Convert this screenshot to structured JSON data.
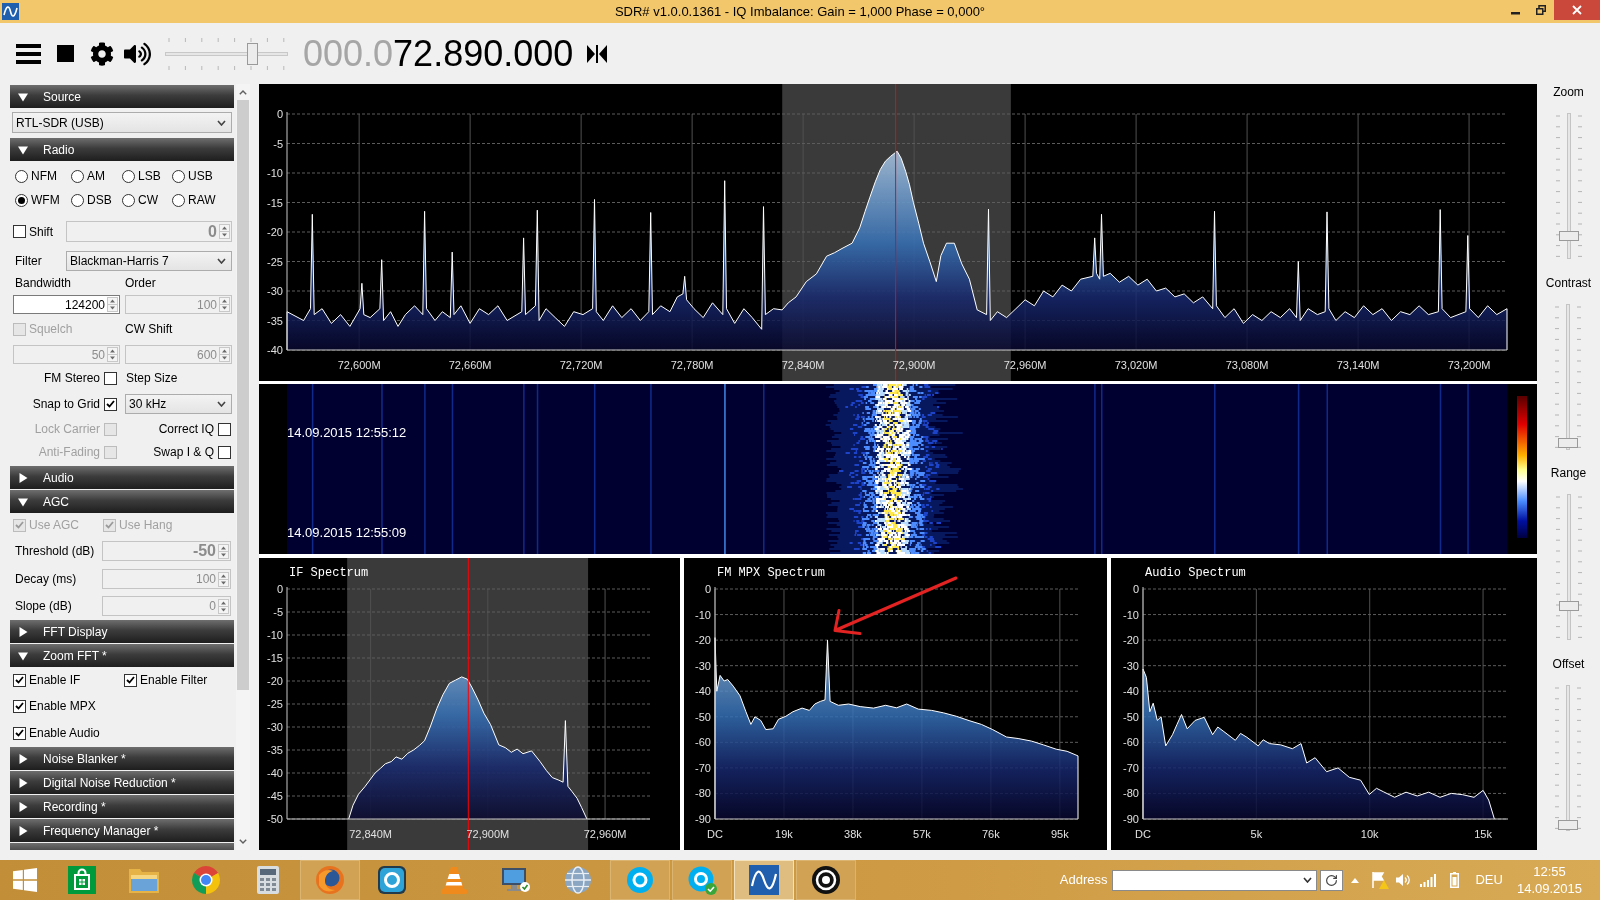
{
  "window": {
    "title": "SDR# v1.0.0.1361 - IQ Imbalance: Gain = 1,000 Phase = 0,000°"
  },
  "toolbar": {
    "volume": {
      "level": 0.72
    },
    "frequency": {
      "leading": "000.0",
      "digits": "72.890.000"
    }
  },
  "sidebar": {
    "sections": [
      {
        "title": "Source",
        "expanded": true,
        "kind": "source",
        "device": "RTL-SDR (USB)"
      },
      {
        "title": "Radio",
        "expanded": true,
        "kind": "radio",
        "modes": [
          {
            "label": "NFM",
            "selected": false
          },
          {
            "label": "AM",
            "selected": false
          },
          {
            "label": "LSB",
            "selected": false
          },
          {
            "label": "USB",
            "selected": false
          },
          {
            "label": "WFM",
            "selected": true
          },
          {
            "label": "DSB",
            "selected": false
          },
          {
            "label": "CW",
            "selected": false
          },
          {
            "label": "RAW",
            "selected": false
          }
        ],
        "shift": {
          "label": "Shift",
          "checked": false,
          "disabled": false
        },
        "shift_value": {
          "value": "0",
          "disabled": true
        },
        "filter": {
          "label": "Filter",
          "value": "Blackman-Harris 7"
        },
        "bandwidth": {
          "label": "Bandwidth",
          "value": "124200",
          "disabled": false
        },
        "order": {
          "label": "Order",
          "value": "100",
          "disabled": true
        },
        "squelch": {
          "label": "Squelch",
          "checked": false,
          "disabled": true
        },
        "squelch_value": {
          "value": "50",
          "disabled": true
        },
        "cw_shift": {
          "label": "CW Shift",
          "value": "600",
          "disabled": true
        },
        "fm_stereo": {
          "label": "FM Stereo",
          "checked": false,
          "disabled": false
        },
        "step_size": {
          "label": "Step Size",
          "value": "30 kHz"
        },
        "snap_to_grid": {
          "label": "Snap to Grid",
          "checked": true,
          "disabled": false
        },
        "lock_carrier": {
          "label": "Lock Carrier",
          "checked": false,
          "disabled": true
        },
        "correct_iq": {
          "label": "Correct IQ",
          "checked": false,
          "disabled": false
        },
        "anti_fading": {
          "label": "Anti-Fading",
          "checked": false,
          "disabled": true
        },
        "swap_iq": {
          "label": "Swap I & Q",
          "checked": false,
          "disabled": false
        }
      },
      {
        "title": "Audio",
        "expanded": false
      },
      {
        "title": "AGC",
        "expanded": true,
        "kind": "agc",
        "use_agc": {
          "label": "Use AGC",
          "checked": true,
          "disabled": true
        },
        "use_hang": {
          "label": "Use Hang",
          "checked": true,
          "disabled": true
        },
        "fields": [
          {
            "label": "Threshold (dB)",
            "value": "-50",
            "disabled": true
          },
          {
            "label": "Decay (ms)",
            "value": "100",
            "disabled": true
          },
          {
            "label": "Slope (dB)",
            "value": "0",
            "disabled": true
          }
        ]
      },
      {
        "title": "FFT Display",
        "expanded": false
      },
      {
        "title": "Zoom FFT *",
        "expanded": true,
        "kind": "zoom_fft",
        "options": [
          {
            "label": "Enable IF",
            "checked": true,
            "disabled": false
          },
          {
            "label": "Enable Filter",
            "checked": true,
            "disabled": false
          },
          {
            "label": "Enable MPX",
            "checked": true,
            "disabled": false
          },
          {
            "label": "Enable Audio",
            "checked": true,
            "disabled": false
          }
        ]
      },
      {
        "title": "Noise Blanker *",
        "expanded": false
      },
      {
        "title": "Digital Noise Reduction *",
        "expanded": false
      },
      {
        "title": "Recording *",
        "expanded": false
      },
      {
        "title": "Frequency Manager *",
        "expanded": false
      }
    ]
  },
  "spectrum": {
    "chart_data": {
      "type": "area",
      "grid": true,
      "xlim": [
        72561,
        73220.5
      ],
      "ylim": [
        -40,
        0
      ],
      "xticks": [
        {
          "value": 72600,
          "label": "72,600M"
        },
        {
          "value": 72660,
          "label": "72,660M"
        },
        {
          "value": 72720,
          "label": "72,720M"
        },
        {
          "value": 72780,
          "label": "72,780M"
        },
        {
          "value": 72840,
          "label": "72,840M"
        },
        {
          "value": 72900,
          "label": "72,900M"
        },
        {
          "value": 72960,
          "label": "72,960M"
        },
        {
          "value": 73020,
          "label": "73,020M"
        },
        {
          "value": 73080,
          "label": "73,080M"
        },
        {
          "value": 73140,
          "label": "73,140M"
        },
        {
          "value": 73200,
          "label": "73,200M"
        }
      ],
      "yticks": [
        0,
        -5,
        -10,
        -15,
        -20,
        -25,
        -30,
        -35,
        -40
      ],
      "x": [
        72561,
        72561,
        72570,
        72573.7,
        72574.7,
        72575.7,
        72580,
        72585,
        72590,
        72595,
        72600.5,
        72601.5,
        72602.5,
        72606,
        72611.2,
        72612.2,
        72613.2,
        72617,
        72621,
        72625,
        72630,
        72634.4,
        72635.4,
        72636.4,
        72641,
        72645,
        72649.3,
        72650.3,
        72651.3,
        72655,
        72660,
        72665,
        72670,
        72675,
        72680,
        72687.9,
        72688.9,
        72689.9,
        72695.3,
        72696.3,
        72697.3,
        72701,
        72706,
        72711,
        72716,
        72721,
        72726.2,
        72727.2,
        72728.2,
        72732,
        72737,
        72742,
        72747,
        72752,
        72756.6,
        72757.6,
        72758.6,
        72763,
        72768,
        72772,
        72775,
        72776,
        72777,
        72781,
        72786,
        72791,
        72796.6,
        72797.6,
        72798.6,
        72803,
        72808,
        72812.5,
        72817.6,
        72818.6,
        72819.6,
        72824,
        72828.7,
        72832,
        72836.2,
        72841.7,
        72847.2,
        72852.7,
        72857,
        72861,
        72866.5,
        72870.6,
        72873.5,
        72876.1,
        72879,
        72881.7,
        72884.5,
        72887.2,
        72890.8,
        72893,
        72895.5,
        72897.5,
        72899.6,
        72902.5,
        72905.1,
        72908.5,
        72912,
        72914.5,
        72917.5,
        72921.7,
        72925.8,
        72929.9,
        72934.1,
        72939.2,
        72940.2,
        72941.2,
        72945,
        72950,
        72955,
        72960,
        72965,
        72970,
        72975,
        72980,
        72985,
        72990,
        72996.6,
        72997.6,
        72998.6,
        73000.3,
        73001.3,
        73002.3,
        73006,
        73011,
        73016,
        73021,
        73026,
        73031,
        73036,
        73041,
        73046,
        73051,
        73056,
        73061.4,
        73062.4,
        73063.4,
        73068,
        73073,
        73078,
        73083,
        73088,
        73093,
        73098,
        73103,
        73106.7,
        73107.7,
        73108.7,
        73113,
        73118,
        73122.2,
        73123.2,
        73124.2,
        73128,
        73133,
        73138,
        73143,
        73148,
        73153,
        73158,
        73163,
        73168,
        73173,
        73178,
        73183.4,
        73184.4,
        73185.4,
        73190,
        73198.3,
        73199.3,
        73200.3,
        73205,
        73210,
        73215,
        73220.5,
        73220.5
      ],
      "values": [
        -40,
        -33.5,
        -35,
        -33,
        -17,
        -34,
        -33,
        -35.5,
        -34,
        -36,
        -33,
        -28.7,
        -34,
        -34.5,
        -33,
        -24.7,
        -35,
        -33.5,
        -36,
        -34,
        -32.5,
        -34,
        -16.5,
        -33,
        -35,
        -33.5,
        -34.5,
        -23.4,
        -34,
        -32.5,
        -35.5,
        -33,
        -34,
        -32.5,
        -35,
        -33.5,
        -21,
        -34,
        -32.5,
        -16.3,
        -35,
        -33,
        -34.5,
        -36,
        -33.5,
        -34,
        -33,
        -14.5,
        -33.5,
        -35,
        -32.5,
        -34.5,
        -33,
        -35,
        -33.5,
        -16.7,
        -34,
        -32.5,
        -33.5,
        -31,
        -30.5,
        -27.5,
        -31.5,
        -33,
        -34.5,
        -32,
        -34,
        -11.3,
        -33,
        -35.5,
        -33,
        -34.5,
        -36.5,
        -15.7,
        -34,
        -33,
        -33.2,
        -32,
        -31,
        -28.4,
        -27.1,
        -24.1,
        -23.5,
        -22.8,
        -21.9,
        -19.3,
        -16.5,
        -14.1,
        -11.5,
        -9.4,
        -8,
        -7.2,
        -6.3,
        -7.5,
        -9.8,
        -12,
        -15,
        -18.5,
        -21.9,
        -25,
        -28.4,
        -24,
        -21.9,
        -21.9,
        -25.4,
        -28,
        -33.2,
        -34,
        -16.1,
        -35,
        -33.5,
        -34.5,
        -33,
        -31.5,
        -32.5,
        -30,
        -31,
        -29,
        -30,
        -28,
        -27.5,
        -21,
        -27,
        -28,
        -17,
        -27.5,
        -27,
        -28.5,
        -27.5,
        -29,
        -28,
        -30,
        -29.5,
        -31,
        -30.5,
        -32,
        -31,
        -33,
        -16.5,
        -32.5,
        -34.5,
        -33,
        -35.5,
        -34,
        -35,
        -33.5,
        -34.5,
        -33,
        -34.5,
        -25,
        -35,
        -33,
        -34,
        -33.5,
        -16.6,
        -33,
        -35,
        -33.5,
        -34.5,
        -32.5,
        -34,
        -33,
        -35,
        -33.5,
        -34,
        -32.5,
        -34,
        -33.5,
        -16.2,
        -33,
        -34.5,
        -33.5,
        -20.6,
        -33,
        -34.5,
        -32.5,
        -34,
        -33,
        -40
      ],
      "bands": [
        {
          "axis": "x",
          "from": 72828.7,
          "to": 72952.3
        }
      ],
      "ref_lines": [
        {
          "axis": "x",
          "value": 72890
        }
      ]
    }
  },
  "waterfall": {
    "timestamps": [
      "14.09.2015 12:55:12",
      "14.09.2015 12:55:09"
    ]
  },
  "zoom_spectra": [
    {
      "chart_data": {
        "type": "area",
        "grid": true,
        "title": "IF Spectrum",
        "xlim": [
          72797.2,
          72983
        ],
        "ylim": [
          -50,
          0
        ],
        "xticks": [
          {
            "value": 72840,
            "label": "72,840M"
          },
          {
            "value": 72900,
            "label": "72,900M"
          },
          {
            "value": 72960,
            "label": "72,960M"
          }
        ],
        "yticks": [
          0,
          -5,
          -10,
          -15,
          -20,
          -25,
          -30,
          -35,
          -40,
          -45,
          -50
        ],
        "x": [
          72828.8,
          72831,
          72833.8,
          72837,
          72842.3,
          72845,
          72847.5,
          72850.7,
          72853,
          72856,
          72859.1,
          72862,
          72865,
          72867.6,
          72870.5,
          72873.9,
          72877,
          72880.3,
          72883.5,
          72886.6,
          72889.5,
          72892,
          72895,
          72898,
          72901.4,
          72905.6,
          72909,
          72912,
          72915,
          72918,
          72922.4,
          72926.7,
          72930,
          72933,
          72936,
          72938.5,
          72939.7,
          72941,
          72943,
          72945.7,
          72948,
          72950.7
        ],
        "values": [
          -50,
          -47,
          -44.6,
          -43,
          -40,
          -39,
          -38,
          -37.5,
          -36.5,
          -37,
          -35.7,
          -35,
          -34,
          -33,
          -30,
          -26,
          -23,
          -20.5,
          -19.8,
          -19.1,
          -19.6,
          -21.5,
          -24.1,
          -27,
          -29.5,
          -33.9,
          -34.5,
          -35.5,
          -34.8,
          -35.8,
          -35.2,
          -37.5,
          -39.5,
          -41,
          -41.5,
          -42,
          -28.6,
          -42.9,
          -44,
          -45.5,
          -47.5,
          -50
        ],
        "bands": [
          {
            "axis": "x",
            "from": 72828,
            "to": 72951.3
          }
        ],
        "ref_lines": [
          {
            "axis": "x",
            "value": 72890
          }
        ]
      }
    },
    {
      "chart_data": {
        "type": "area",
        "grid": true,
        "title": "FM MPX Spectrum",
        "xlim": [
          0,
          100
        ],
        "ylim": [
          -90,
          0
        ],
        "xticks": [
          {
            "value": 0,
            "label": "DC"
          },
          {
            "value": 19,
            "label": "19k"
          },
          {
            "value": 38,
            "label": "38k"
          },
          {
            "value": 57,
            "label": "57k"
          },
          {
            "value": 76,
            "label": "76k"
          },
          {
            "value": 95,
            "label": "95k"
          }
        ],
        "yticks": [
          0,
          -10,
          -20,
          -30,
          -40,
          -50,
          -60,
          -70,
          -80,
          -90
        ],
        "x": [
          0,
          0,
          0.5,
          1.4,
          2.5,
          3.5,
          5,
          6.9,
          8.5,
          9.9,
          11,
          12.6,
          14,
          16,
          17.5,
          19.5,
          21.5,
          24,
          26,
          27.5,
          29,
          30.3,
          31,
          31.7,
          34,
          36.8,
          40,
          43.7,
          47,
          50,
          52.8,
          56,
          59.7,
          63,
          66.5,
          70,
          73.4,
          76.5,
          80.3,
          83.5,
          87.2,
          90.5,
          94,
          97,
          100,
          100
        ],
        "values": [
          -90,
          -19,
          -40,
          -33.8,
          -36,
          -35.4,
          -38,
          -41.8,
          -48,
          -53,
          -50,
          -51.4,
          -55,
          -54.7,
          -51,
          -49.8,
          -48,
          -46.6,
          -47.5,
          -45,
          -44,
          -43.4,
          -20,
          -44,
          -45.5,
          -45,
          -46,
          -46.6,
          -45.5,
          -46.5,
          -45,
          -47,
          -47.5,
          -48.5,
          -49.8,
          -51.5,
          -53,
          -55,
          -57.9,
          -58.5,
          -59.5,
          -61,
          -62.7,
          -63.5,
          -65.3,
          -90
        ]
      }
    },
    {
      "chart_data": {
        "type": "area",
        "grid": true,
        "title": "Audio Spectrum",
        "xlim": [
          0,
          16.1
        ],
        "ylim": [
          -90,
          0
        ],
        "xticks": [
          {
            "value": 0,
            "label": "DC"
          },
          {
            "value": 5,
            "label": "5k"
          },
          {
            "value": 10,
            "label": "10k"
          },
          {
            "value": 15,
            "label": "15k"
          }
        ],
        "yticks": [
          0,
          -10,
          -20,
          -30,
          -40,
          -50,
          -60,
          -70,
          -80,
          -90
        ],
        "x": [
          0,
          0,
          0.15,
          0.3,
          0.45,
          0.63,
          0.8,
          1.0,
          1.3,
          1.5,
          1.7,
          1.95,
          2.3,
          2.7,
          3.07,
          3.3,
          3.57,
          4.07,
          4.3,
          4.58,
          5.08,
          5.3,
          5.58,
          6.08,
          6.59,
          6.97,
          7.22,
          7.59,
          8.1,
          8.6,
          9.1,
          9.6,
          9.98,
          10.3,
          10.6,
          11.1,
          11.6,
          12.1,
          12.6,
          13.1,
          13.6,
          14.1,
          14.6,
          15.0,
          15.25,
          15.5
        ],
        "values": [
          -90,
          -31.3,
          -34.6,
          -48,
          -44.7,
          -51.4,
          -50,
          -61.4,
          -57,
          -53,
          -49.1,
          -54.7,
          -51.4,
          -50.2,
          -57,
          -54,
          -55.8,
          -59.2,
          -56.5,
          -58,
          -61.4,
          -59,
          -60.5,
          -61,
          -62.5,
          -60.5,
          -68.1,
          -66,
          -71.5,
          -70,
          -73.7,
          -74.8,
          -80.4,
          -78,
          -79.3,
          -81.5,
          -79.5,
          -81,
          -79.5,
          -81.5,
          -80,
          -80.5,
          -81.5,
          -78.8,
          -82.6,
          -90
        ]
      }
    }
  ],
  "view_controls": [
    {
      "label": "Zoom",
      "level": 0.14
    },
    {
      "label": "Contrast",
      "level": 0.03
    },
    {
      "label": "Range",
      "level": 0.22
    },
    {
      "label": "Offset",
      "level": 0.02
    }
  ],
  "taskbar": {
    "apps": [
      {
        "kind": "panes",
        "running": false,
        "selected": false
      },
      {
        "kind": "bag",
        "running": false,
        "selected": false
      },
      {
        "kind": "folder",
        "running": false,
        "selected": false
      },
      {
        "kind": "ring",
        "running": false,
        "selected": false
      },
      {
        "kind": "calculator",
        "running": false,
        "selected": false
      },
      {
        "kind": "orb",
        "running": true,
        "selected": false
      },
      {
        "kind": "tile",
        "running": false,
        "selected": false
      },
      {
        "kind": "cone",
        "running": false,
        "selected": false
      },
      {
        "kind": "monitor",
        "running": false,
        "selected": false
      },
      {
        "kind": "globe",
        "running": false,
        "selected": false
      },
      {
        "kind": "cloud",
        "running": true,
        "selected": false
      },
      {
        "kind": "cloudcheck",
        "running": true,
        "selected": false
      },
      {
        "kind": "wave",
        "running": true,
        "selected": true
      },
      {
        "kind": "eye",
        "running": true,
        "selected": false
      }
    ],
    "address": {
      "label": "Address"
    },
    "tray": {
      "language": "DEU",
      "time": "12:55",
      "date": "14.09.2015"
    }
  }
}
